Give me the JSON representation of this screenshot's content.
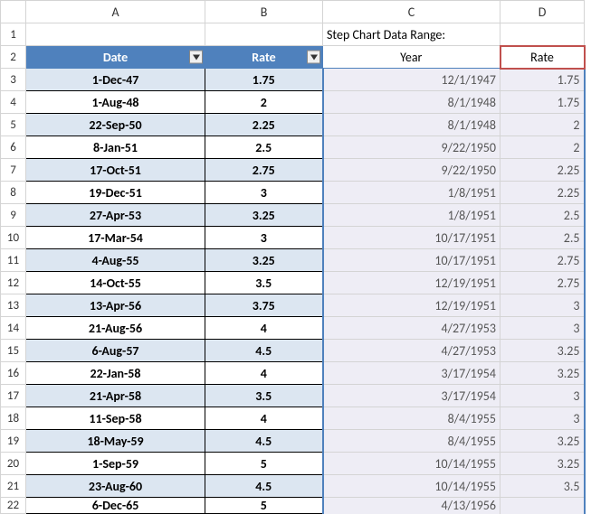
{
  "columns": [
    "A",
    "B",
    "C",
    "D"
  ],
  "rows": [
    "1",
    "2",
    "3",
    "4",
    "5",
    "6",
    "7",
    "8",
    "9",
    "10",
    "11",
    "12",
    "13",
    "14",
    "15",
    "16",
    "17",
    "18",
    "19",
    "20",
    "21",
    "22"
  ],
  "step_chart_title": "Step Chart Data Range:",
  "headers": {
    "date": "Date",
    "rate": "Rate",
    "year": "Year",
    "rate2": "Rate"
  },
  "table_ab": [
    {
      "date": "1-Dec-47",
      "rate": "1.75"
    },
    {
      "date": "1-Aug-48",
      "rate": "2"
    },
    {
      "date": "22-Sep-50",
      "rate": "2.25"
    },
    {
      "date": "8-Jan-51",
      "rate": "2.5"
    },
    {
      "date": "17-Oct-51",
      "rate": "2.75"
    },
    {
      "date": "19-Dec-51",
      "rate": "3"
    },
    {
      "date": "27-Apr-53",
      "rate": "3.25"
    },
    {
      "date": "17-Mar-54",
      "rate": "3"
    },
    {
      "date": "4-Aug-55",
      "rate": "3.25"
    },
    {
      "date": "14-Oct-55",
      "rate": "3.5"
    },
    {
      "date": "13-Apr-56",
      "rate": "3.75"
    },
    {
      "date": "21-Aug-56",
      "rate": "4"
    },
    {
      "date": "6-Aug-57",
      "rate": "4.5"
    },
    {
      "date": "22-Jan-58",
      "rate": "4"
    },
    {
      "date": "21-Apr-58",
      "rate": "3.5"
    },
    {
      "date": "11-Sep-58",
      "rate": "4"
    },
    {
      "date": "18-May-59",
      "rate": "4.5"
    },
    {
      "date": "1-Sep-59",
      "rate": "5"
    },
    {
      "date": "23-Aug-60",
      "rate": "4.5"
    },
    {
      "date": "6-Dec-65",
      "rate": "5"
    }
  ],
  "table_cd": [
    {
      "year": "12/1/1947",
      "rate": "1.75"
    },
    {
      "year": "8/1/1948",
      "rate": "1.75"
    },
    {
      "year": "8/1/1948",
      "rate": "2"
    },
    {
      "year": "9/22/1950",
      "rate": "2"
    },
    {
      "year": "9/22/1950",
      "rate": "2.25"
    },
    {
      "year": "1/8/1951",
      "rate": "2.25"
    },
    {
      "year": "1/8/1951",
      "rate": "2.5"
    },
    {
      "year": "10/17/1951",
      "rate": "2.5"
    },
    {
      "year": "10/17/1951",
      "rate": "2.75"
    },
    {
      "year": "12/19/1951",
      "rate": "2.75"
    },
    {
      "year": "12/19/1951",
      "rate": "3"
    },
    {
      "year": "4/27/1953",
      "rate": "3"
    },
    {
      "year": "4/27/1953",
      "rate": "3.25"
    },
    {
      "year": "3/17/1954",
      "rate": "3.25"
    },
    {
      "year": "3/17/1954",
      "rate": "3"
    },
    {
      "year": "8/4/1955",
      "rate": "3"
    },
    {
      "year": "8/4/1955",
      "rate": "3.25"
    },
    {
      "year": "10/14/1955",
      "rate": "3.25"
    },
    {
      "year": "10/14/1955",
      "rate": "3.5"
    },
    {
      "year": "4/13/1956",
      "rate": ""
    }
  ]
}
